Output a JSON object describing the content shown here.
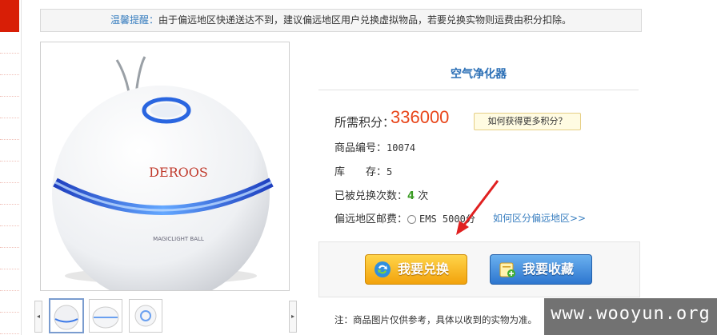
{
  "notice": {
    "label": "温馨提醒：",
    "text": "由于偏远地区快递送达不到，建议偏远地区用户兑换虚拟物品，若要兑换实物则运费由积分扣除。"
  },
  "product": {
    "title": "空气净化器",
    "points_label": "所需积分：",
    "points_value": "336000",
    "how_to_earn": "如何获得更多积分？",
    "code_label": "商品编号：",
    "code_value": "10074",
    "stock_label": "库　　存：",
    "stock_value": "5",
    "exchanged_label": "已被兑换次数：",
    "exchanged_count": "4",
    "exchanged_unit": "次",
    "remote_shipping_label": "偏远地区邮费：",
    "shipping_option": "EMS 5000分",
    "region_link": "如何区分偏远地区>>",
    "brand_on_image": "DEROOS",
    "model_on_image": "MAGICLIGHT BALL"
  },
  "buttons": {
    "exchange": "我要兑换",
    "favorite": "我要收藏"
  },
  "note": "注：商品图片仅供参考，具体以收到的实物为准。",
  "watermark": "www.wooyun.org",
  "colors": {
    "points": "#e8461b",
    "link": "#3a7fc0",
    "title": "#2b6fb6",
    "count": "#3c9c25",
    "exchange_button": "#f2a20c",
    "favorite_button": "#2d76cf"
  }
}
